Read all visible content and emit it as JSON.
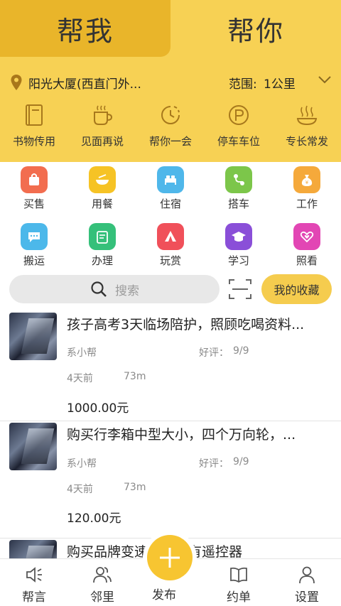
{
  "tabs": {
    "left": "帮我",
    "right": "帮你"
  },
  "location": {
    "address": "阳光大厦(西直门外...",
    "range_label": "范围:",
    "range_value": "1公里"
  },
  "categories": [
    {
      "label": "书物传用",
      "icon": "book-icon"
    },
    {
      "label": "见面再说",
      "icon": "coffee-cup-icon"
    },
    {
      "label": "帮你一会",
      "icon": "clock-icon"
    },
    {
      "label": "停车车位",
      "icon": "parking-icon"
    },
    {
      "label": "专长常发",
      "icon": "steam-bowl-icon"
    }
  ],
  "services": [
    {
      "label": "买售",
      "color": "#f26d4f",
      "icon": "shopping-bag-icon"
    },
    {
      "label": "用餐",
      "color": "#f6c325",
      "icon": "dish-icon"
    },
    {
      "label": "住宿",
      "color": "#4fb7ea",
      "icon": "bed-icon"
    },
    {
      "label": "搭车",
      "color": "#7cc64a",
      "icon": "route-icon"
    },
    {
      "label": "工作",
      "color": "#f5a93b",
      "icon": "money-bag-icon"
    },
    {
      "label": "搬运",
      "color": "#4cb8ea",
      "icon": "chat-bubble-icon"
    },
    {
      "label": "办理",
      "color": "#35c07a",
      "icon": "clipboard-icon"
    },
    {
      "label": "玩赏",
      "color": "#f0505a",
      "icon": "tent-icon"
    },
    {
      "label": "学习",
      "color": "#8a4fd8",
      "icon": "graduation-cap-icon"
    },
    {
      "label": "照看",
      "color": "#e246b4",
      "icon": "heart-hands-icon"
    }
  ],
  "search": {
    "placeholder": "搜索",
    "favorites_label": "我的收藏"
  },
  "listings": [
    {
      "title": "孩子高考3天临场陪护，照顾吃喝资料...",
      "author": "系小帮",
      "rating_label": "好评：",
      "rating": "9/9",
      "time": "4天前",
      "distance": "73m",
      "price": "1000.00元"
    },
    {
      "title": "购买行李箱中型大小，四个万向轮，...",
      "author": "系小帮",
      "rating_label": "好评：",
      "rating": "9/9",
      "time": "4天前",
      "distance": "73m",
      "price": "120.00元"
    },
    {
      "title": "购买品牌变速工具，有遥控器"
    }
  ],
  "bottom_nav": [
    {
      "label": "帮言",
      "icon": "speaker-icon"
    },
    {
      "label": "邻里",
      "icon": "neighbors-icon"
    },
    {
      "label": "发布",
      "icon": "plus-icon"
    },
    {
      "label": "约单",
      "icon": "open-book-icon"
    },
    {
      "label": "设置",
      "icon": "person-icon"
    }
  ],
  "colors": {
    "header_yellow": "#f7d154",
    "active_tab": "#e9b52a",
    "accent": "#f5cc4e"
  }
}
